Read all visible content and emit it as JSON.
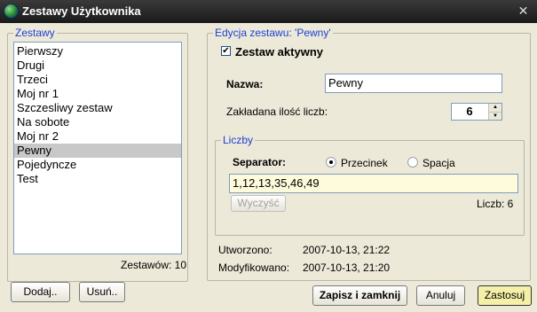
{
  "window": {
    "title": "Zestawy Użytkownika",
    "close_glyph": "✕"
  },
  "left": {
    "legend": "Zestawy",
    "items": [
      "Pierwszy",
      "Drugi",
      "Trzeci",
      "Moj nr 1",
      "Szczesliwy zestaw",
      "Na sobote",
      "Moj nr 2",
      "Pewny",
      "Pojedyncze",
      "Test"
    ],
    "selected_index": 7,
    "count_text": "Zestawów: 10",
    "add_label": "Dodaj..",
    "remove_label": "Usuń.."
  },
  "right": {
    "legend": "Edycja zestawu: 'Pewny'",
    "active_label": "Zestaw aktywny",
    "active_checked": true,
    "name_label": "Nazwa:",
    "name_value": "Pewny",
    "count_label": "Zakładana ilość liczb:",
    "count_value": "6",
    "numbers_group": {
      "legend": "Liczby",
      "separator_label": "Separator:",
      "option_comma": "Przecinek",
      "option_space": "Spacja",
      "selected": "comma",
      "numbers_value": "1,12,13,35,46,49",
      "clear_label": "Wyczyść",
      "count_text": "Liczb: 6"
    },
    "created_label": "Utworzono:",
    "created_value": "2007-10-13,  21:22",
    "modified_label": "Modyfikowano:",
    "modified_value": "2007-10-13,  21:20"
  },
  "footer": {
    "save_close_label": "Zapisz i zamknij",
    "cancel_label": "Anuluj",
    "apply_label": "Zastosuj"
  }
}
